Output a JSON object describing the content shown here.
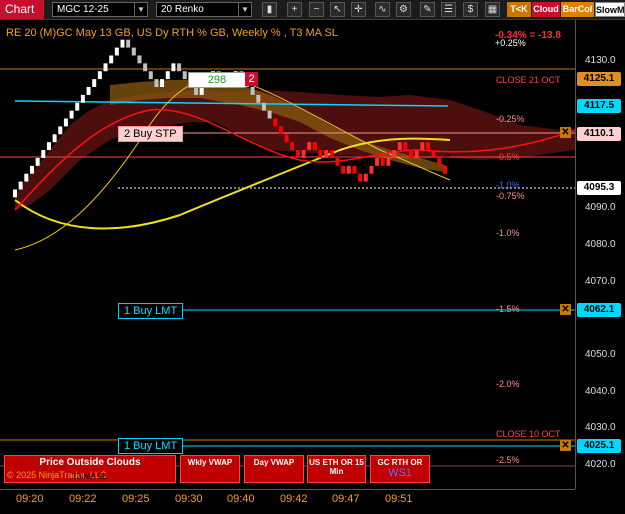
{
  "toolbar": {
    "chart_tab": "Chart",
    "instrument": "MGC 12-25",
    "bar_type": "20 Renko",
    "btn_tk": "T<K",
    "btn_cloud": "Cloud",
    "btn_barcol": "BarCol",
    "btn_slowma": "SlowM"
  },
  "chart_title": "RE 20  (M)GC May 13 GB, US Dy RTH % GB, Weekly % , T3 MA SL",
  "pnl": {
    "pct": "-0.34% = -13.8",
    "small": "+0.25%"
  },
  "price_axis": {
    "ticks": [
      "4130.0",
      "4090.0",
      "4080.0",
      "4070.0",
      "4050.0",
      "4040.0",
      "4030.0",
      "4020.0"
    ],
    "labels": [
      "4125.1",
      "4117.5",
      "4110.1",
      "4095.3",
      "4062.1",
      "4025.1"
    ]
  },
  "orders": {
    "buy_stp": "2 Buy STP",
    "buy_lmt_1": "1 Buy LMT",
    "buy_lmt_2": "1 Buy LMT",
    "box_value": "298",
    "box_qty": "2"
  },
  "levels": {
    "close_21": "CLOSE 21 OCT",
    "close_10": "CLOSE 10 OCT",
    "pct_a": "-0.25%",
    "pct_b": "-0.5%",
    "pct_c": "-0.75%",
    "pct_c2": "-1.0%",
    "pct_d": "-1.0%",
    "pct_e": "-1.5%",
    "pct_f": "-2.0%",
    "pct_g": "-2.5%"
  },
  "x_axis": [
    "09:20",
    "09:22",
    "09:25",
    "09:30",
    "09:40",
    "09:42",
    "09:47",
    "09:51"
  ],
  "panels": {
    "clouds": "Price Outside Clouds",
    "copyright": "© 2025 NinjaTrader, LLC",
    "t3": "T3 MA SL",
    "wkly": "Wkly VWAP",
    "day": "Day VWAP",
    "useth": "US ETH OR 15 Min",
    "gcrth": "GC RTH OR",
    "ws1": "WS1"
  },
  "colors": {
    "accent_red": "#c8102e",
    "price_line_cyan": "#00d8ff",
    "ma_yellow": "#f0e020",
    "cloud_orange": "#c87800",
    "bar_up": "#ffffff",
    "bar_down": "#ff0000"
  },
  "chart_data": {
    "type": "renko",
    "bricks_y_close": [
      4092,
      4094,
      4096,
      4098,
      4100,
      4102,
      4104,
      4106,
      4108,
      4110,
      4112,
      4114,
      4116,
      4118,
      4120,
      4122,
      4124,
      4126,
      4128,
      4130,
      4128,
      4126,
      4124,
      4122,
      4120,
      4118,
      4120,
      4122,
      4124,
      4122,
      4120,
      4118,
      4116,
      4118,
      4120,
      4122,
      4120,
      4118,
      4120,
      4122,
      4120,
      4118,
      4116,
      4114,
      4112,
      4110,
      4108,
      4106,
      4104,
      4102,
      4100,
      4102,
      4104,
      4102,
      4100,
      4102,
      4100,
      4098,
      4096,
      4098,
      4096,
      4094,
      4096,
      4098,
      4100,
      4098,
      4100,
      4102,
      4104,
      4102,
      4100,
      4102,
      4104,
      4102,
      4100,
      4098,
      4096
    ],
    "ylim": [
      4016,
      4135
    ],
    "ma_t3": [
      4086,
      4083,
      4082,
      4082,
      4083,
      4085,
      4088,
      4092,
      4095,
      4098,
      4101,
      4103,
      4105,
      4106,
      4107,
      4108,
      4108,
      4108
    ],
    "ma_slow": [
      4078,
      4080,
      4085,
      4092,
      4100,
      4110,
      4120,
      4126,
      4128,
      4126,
      4122,
      4117,
      4112,
      4108,
      4104,
      4100,
      4097,
      4095
    ]
  }
}
